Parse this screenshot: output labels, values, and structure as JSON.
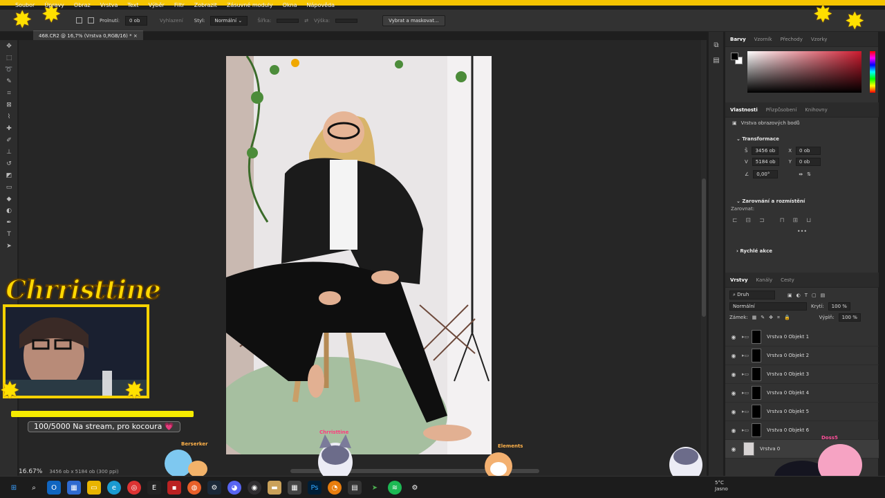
{
  "menu": [
    "Soubor",
    "Úpravy",
    "Obraz",
    "Vrstva",
    "Text",
    "Výběr",
    "Filtr",
    "Zobrazit",
    "Zásuvné moduly",
    "Okna",
    "Nápověda"
  ],
  "options": {
    "feather_label": "Prolnutí:",
    "feather_value": "0 ob",
    "smoothing_label": "Vyhlazení",
    "style_label": "Styl:",
    "style_value": "Normální",
    "width_label": "Šířka:",
    "height_label": "Výška:",
    "select_mask_button": "Vybrat a maskovat..."
  },
  "document_tab": "468.CR2 @ 16,7% (Vrstva 0,RGB/16) *",
  "status": {
    "zoom": "16.67%",
    "doc_info": "3456 ob x 5184 ob (300 ppi)"
  },
  "color_panel": {
    "tabs": [
      "Barvy",
      "Vzorník",
      "Přechody",
      "Vzorky"
    ],
    "accent": "#cc1a2e"
  },
  "properties": {
    "tabs": [
      "Vlastnosti",
      "Přizpůsobení",
      "Knihovny"
    ],
    "layer_type": "Vrstva obrazových bodů",
    "transform_title": "Transformace",
    "w_label": "Š",
    "w_value": "3456 ob",
    "h_label": "V",
    "h_value": "5184 ob",
    "x_label": "X",
    "x_value": "0 ob",
    "y_label": "Y",
    "y_value": "0 ob",
    "angle_value": "0,00°",
    "align_title": "Zarovnání a rozmístění",
    "align_label": "Zarovnat:",
    "quick_title": "Rychlé akce"
  },
  "layers_panel": {
    "tabs": [
      "Vrstvy",
      "Kanály",
      "Cesty"
    ],
    "filter": "Druh",
    "blend_mode": "Normální",
    "opacity_label": "Krytí:",
    "opacity_value": "100 %",
    "lock_label": "Zámek:",
    "fill_label": "Výplň:",
    "fill_value": "100 %",
    "layers": [
      "Vrstva 0 Objekt 1",
      "Vrstva 0 Objekt 2",
      "Vrstva 0 Objekt 3",
      "Vrstva 0 Objekt 4",
      "Vrstva 0 Objekt 5",
      "Vrstva 0 Objekt 6",
      "Vrstva 0"
    ]
  },
  "overlay": {
    "streamer": "Chrristtine",
    "goal_text": "100/5000 Na stream, pro kocoura 💗",
    "chat_names": [
      "Chrristtine",
      "Berserker",
      "Doss5",
      "Elements"
    ],
    "chat_names_colors": [
      "#ff3a7c",
      "#ffb24a",
      "#ff4f9a",
      "#ffb24a"
    ]
  },
  "taskbar": {
    "weather_temp": "5°C",
    "weather_text": "Jasno"
  }
}
